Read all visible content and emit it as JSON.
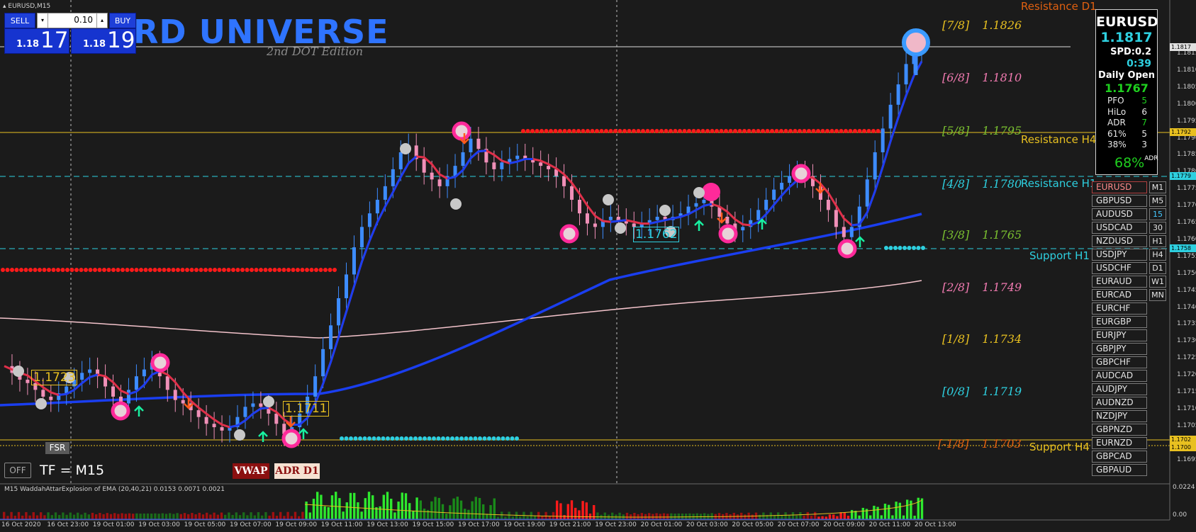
{
  "chart_title": "EURUSD,M15",
  "watermark": {
    "title": "RD UNIVERSE",
    "subtitle": "2nd DOT Edition"
  },
  "trade_panel": {
    "sell_label": "SELL",
    "buy_label": "BUY",
    "lot_value": "0.10",
    "sell_prefix": "1.18",
    "sell_big": "17",
    "buy_prefix": "1.18",
    "buy_big": "19"
  },
  "info_panel": {
    "symbol": "EURUSD",
    "price": "1.1817",
    "spread": "SPD:0.2",
    "timer": "0:39",
    "daily_open_label": "Daily Open",
    "daily_open": "1.1767",
    "stats": [
      {
        "label": "PFO",
        "value": "5",
        "color": "#1fd01f"
      },
      {
        "label": "HiLo",
        "value": "6",
        "color": "#e8e8e8"
      },
      {
        "label": "ADR",
        "value": "7",
        "color": "#1fd01f"
      },
      {
        "label": "61%",
        "value": "5",
        "color": "#e8e8e8"
      },
      {
        "label": "38%",
        "value": "3",
        "color": "#e8e8e8"
      }
    ],
    "adr_percent": "68%",
    "adr_suffix": "ADR"
  },
  "symbols": [
    "EURUSD",
    "GBPUSD",
    "AUDUSD",
    "USDCAD",
    "NZDUSD",
    "USDJPY",
    "USDCHF",
    "EURAUD",
    "EURCAD",
    "EURCHF",
    "EURGBP",
    "EURJPY",
    "GBPJPY",
    "GBPCHF",
    "AUDCAD",
    "AUDJPY",
    "AUDNZD",
    "NZDJPY",
    "GBPNZD",
    "EURNZD",
    "GBPCAD",
    "GBPAUD"
  ],
  "timeframes": [
    "M1",
    "M5",
    "15",
    "30",
    "H1",
    "H4",
    "D1",
    "W1",
    "MN"
  ],
  "active_symbol": "EURUSD",
  "active_timeframe": "15",
  "murrey": [
    {
      "label": "[7/8]",
      "value": "1.1826",
      "color": "#e8c020"
    },
    {
      "label": "[6/8]",
      "value": "1.1810",
      "color": "#f07ab0"
    },
    {
      "label": "[5/8]",
      "value": "1.1795",
      "color": "#7ac030"
    },
    {
      "label": "[4/8]",
      "value": "1.1780",
      "color": "#2ed0e0"
    },
    {
      "label": "[3/8]",
      "value": "1.1765",
      "color": "#7ac030"
    },
    {
      "label": "[2/8]",
      "value": "1.1749",
      "color": "#f07ab0"
    },
    {
      "label": "[1/8]",
      "value": "1.1734",
      "color": "#e8c020"
    },
    {
      "label": "[0/8]",
      "value": "1.1719",
      "color": "#2ed0e0"
    },
    {
      "label": "[-1/8]",
      "value": "1.1703",
      "color": "#e06010"
    }
  ],
  "sr_labels": {
    "resistance_d1": "Resistance D1",
    "resistance_h4": "Resistance H4",
    "resistance_h1": "Resistance H1",
    "support_h1": "Support H1",
    "support_h4": "Support H4"
  },
  "price_axis": [
    "1.1815",
    "1.1810",
    "1.1805",
    "1.1800",
    "1.1795",
    "1.1790",
    "1.1785",
    "1.1780",
    "1.1775",
    "1.1770",
    "1.1765",
    "1.1760",
    "1.1755",
    "1.1750",
    "1.1745",
    "1.1740",
    "1.1735",
    "1.1730",
    "1.1725",
    "1.1720",
    "1.1715",
    "1.1710",
    "1.1705",
    "1.1700",
    "1.1695"
  ],
  "price_tags": [
    {
      "text": "1.1817",
      "bg": "#e0e0e0"
    },
    {
      "text": "1.1792",
      "bg": "#e8c020"
    },
    {
      "text": "1.1779",
      "bg": "#2ed0e0"
    },
    {
      "text": "1.1758",
      "bg": "#2ed0e0"
    },
    {
      "text": "1.1702",
      "bg": "#e8c020"
    },
    {
      "text": "1.1700",
      "bg": "#e8c020"
    }
  ],
  "time_axis": [
    "16 Oct 2020",
    "16 Oct 23:00",
    "19 Oct 01:00",
    "19 Oct 03:00",
    "19 Oct 05:00",
    "19 Oct 07:00",
    "19 Oct 09:00",
    "19 Oct 11:00",
    "19 Oct 13:00",
    "19 Oct 15:00",
    "19 Oct 17:00",
    "19 Oct 19:00",
    "19 Oct 21:00",
    "19 Oct 23:00",
    "20 Oct 01:00",
    "20 Oct 03:00",
    "20 Oct 05:00",
    "20 Oct 07:00",
    "20 Oct 09:00",
    "20 Oct 11:00",
    "20 Oct 13:00"
  ],
  "chart_labels": {
    "l1": "1.1723",
    "l2": "1.1711",
    "l3": "1.1762"
  },
  "fsr_label": "FSR",
  "off_label": "OFF",
  "tf_label": "TF = M15",
  "vwap_label": "VWAP",
  "adr_d1_label": "ADR D1",
  "sub_title": "M15  WaddahAttarExplosion of EMA (20,40,21) 0.0153 0.0071 0.0021",
  "sub_axis": [
    "0.0224",
    "0.00"
  ],
  "price_series": [
    1.1723,
    1.1721,
    1.1719,
    1.1718,
    1.1716,
    1.1714,
    1.1713,
    1.1715,
    1.1717,
    1.1719,
    1.1721,
    1.1722,
    1.172,
    1.1717,
    1.1714,
    1.1712,
    1.1716,
    1.172,
    1.1722,
    1.1724,
    1.172,
    1.1716,
    1.1713,
    1.1712,
    1.171,
    1.1708,
    1.1706,
    1.1705,
    1.1704,
    1.1705,
    1.1708,
    1.1711,
    1.1712,
    1.1711,
    1.1709,
    1.1706,
    1.1703,
    1.1705,
    1.1709,
    1.1714,
    1.172,
    1.1728,
    1.1735,
    1.1743,
    1.175,
    1.1758,
    1.1764,
    1.1768,
    1.1772,
    1.1776,
    1.1781,
    1.1786,
    1.1788,
    1.1784,
    1.178,
    1.1778,
    1.1776,
    1.1779,
    1.1782,
    1.1786,
    1.179,
    1.1787,
    1.1783,
    1.1781,
    1.1783,
    1.1784,
    1.1785,
    1.1784,
    1.1783,
    1.1782,
    1.1781,
    1.1779,
    1.1776,
    1.1772,
    1.1768,
    1.1765,
    1.1764,
    1.1766,
    1.1767,
    1.1766,
    1.1765,
    1.1764,
    1.1765,
    1.1766,
    1.1767,
    1.1766,
    1.1767,
    1.1768,
    1.177,
    1.1771,
    1.1772,
    1.177,
    1.1767,
    1.1765,
    1.1763,
    1.1764,
    1.1766,
    1.1769,
    1.1772,
    1.1775,
    1.1777,
    1.1779,
    1.178,
    1.1779,
    1.1776,
    1.1772,
    1.1769,
    1.1764,
    1.1761,
    1.1764,
    1.177,
    1.1778,
    1.1786,
    1.1793,
    1.18,
    1.1806,
    1.1812,
    1.1816,
    1.1817
  ]
}
